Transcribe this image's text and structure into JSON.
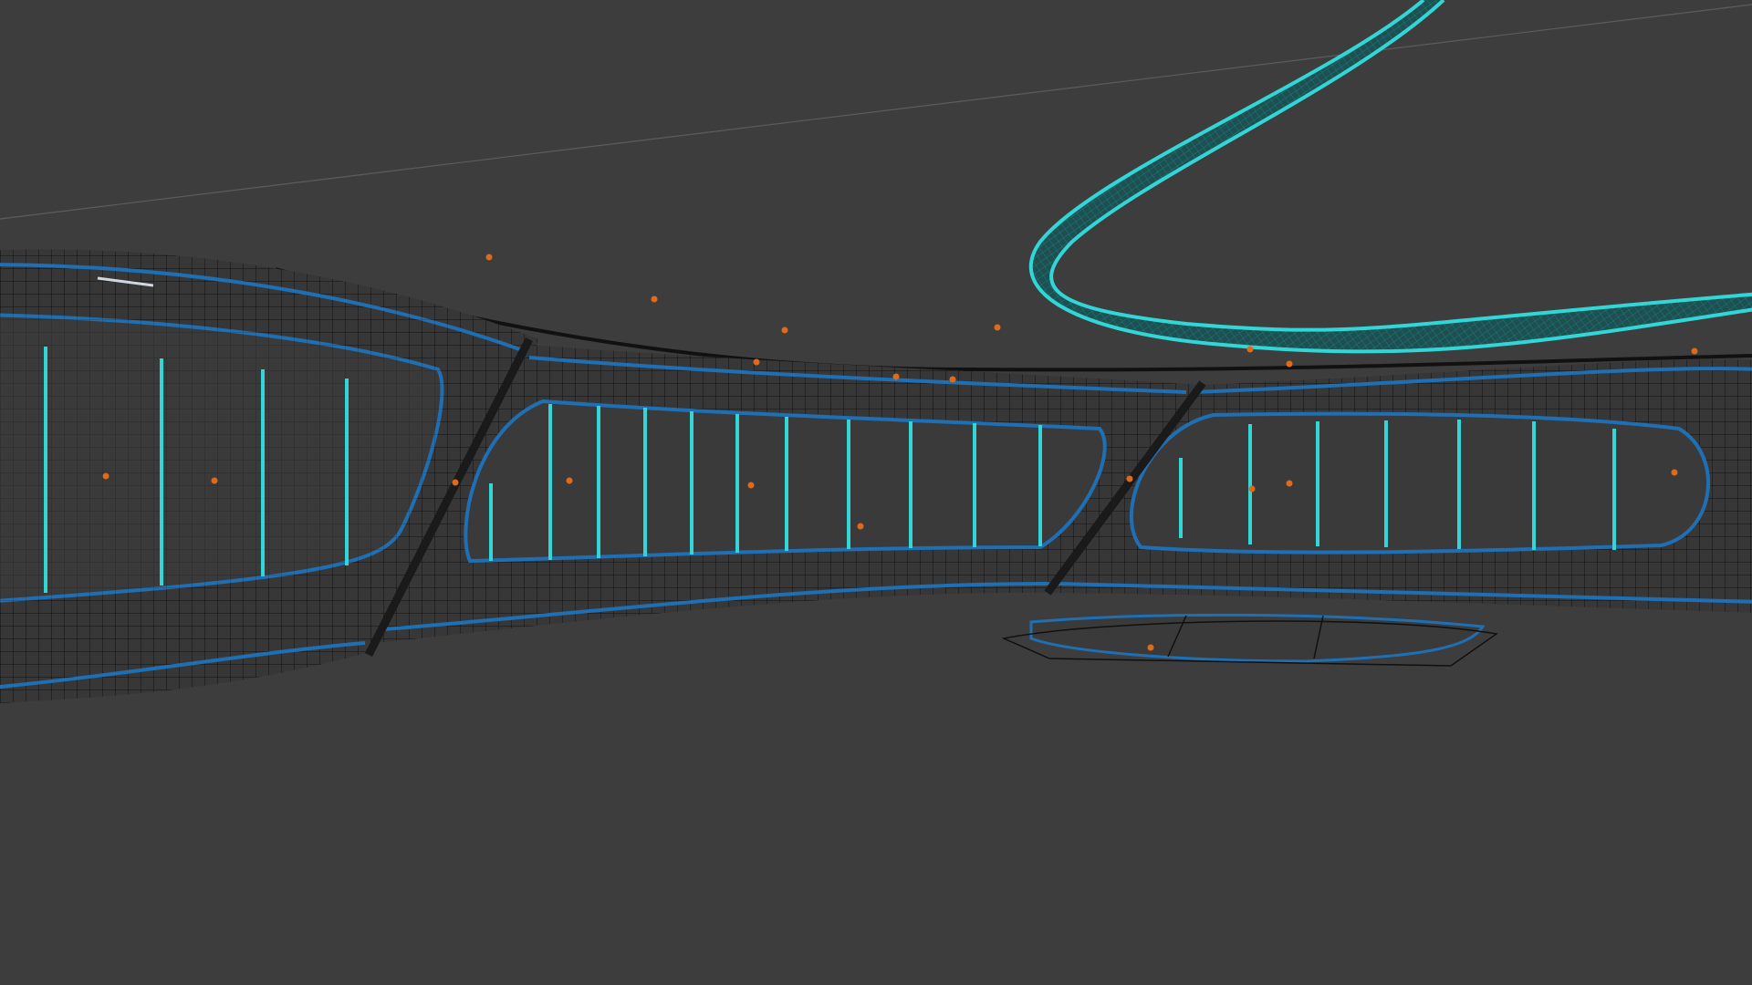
{
  "viewport": {
    "background": "#3d3d3d",
    "wire_color": "#101010",
    "edge_color": "#1f6fb4",
    "accent_color": "#33d6d6",
    "seam_color": "#1a1a1a",
    "origin_color": "#e06a1a",
    "floor_line_color": "#6a6a6a"
  }
}
